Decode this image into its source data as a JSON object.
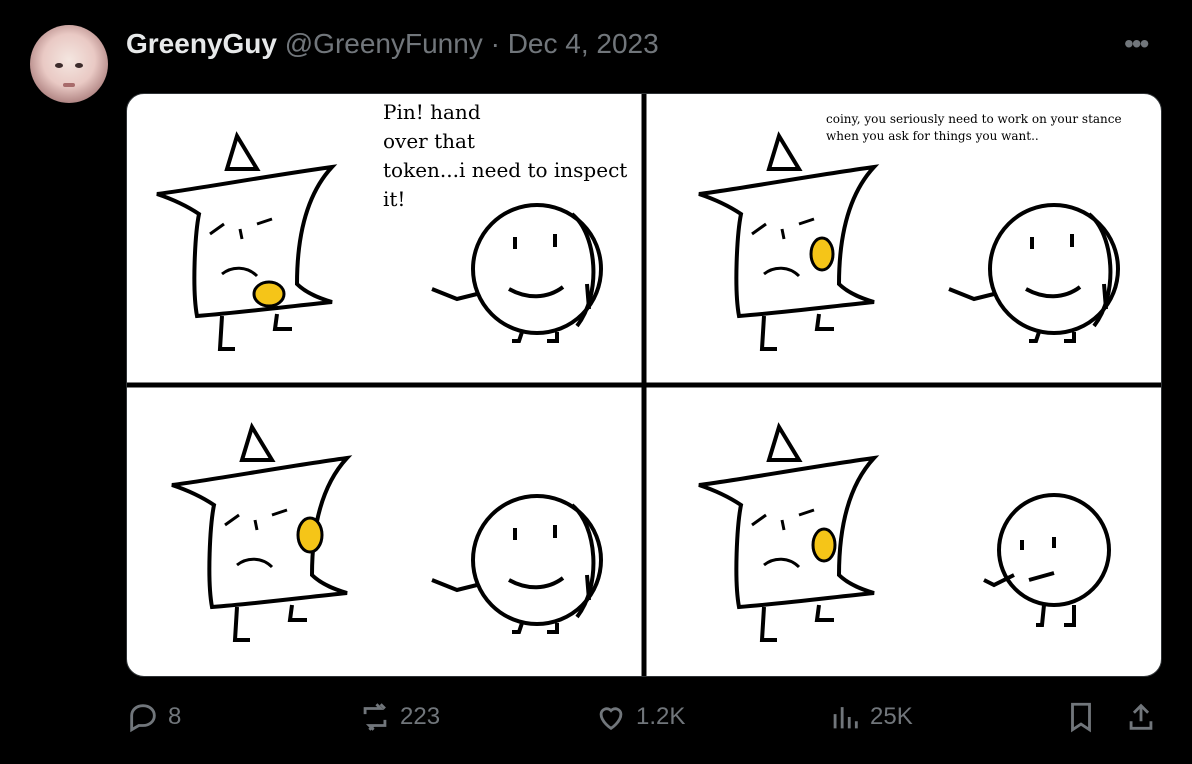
{
  "post": {
    "author_name": "GreenyGuy",
    "handle": "@GreenyFunny",
    "separator": "·",
    "date": "Dec 4, 2023",
    "more_icon": "more-icon"
  },
  "comic": {
    "panel1_text": [
      "Pin! hand",
      "over that",
      "token...i need to inspect",
      "it!"
    ],
    "panel2_text": [
      "coiny, you seriously need to work on your stance",
      "when you ask for things you want.."
    ]
  },
  "actions": {
    "replies": "8",
    "reposts": "223",
    "likes": "1.2K",
    "views": "25K",
    "icons": [
      "reply-icon",
      "repost-icon",
      "like-icon",
      "views-icon",
      "bookmark-icon",
      "share-icon"
    ]
  },
  "colors": {
    "background": "#000000",
    "muted": "#71767b",
    "text": "#e7e9ea",
    "coin": "#f5c518"
  }
}
